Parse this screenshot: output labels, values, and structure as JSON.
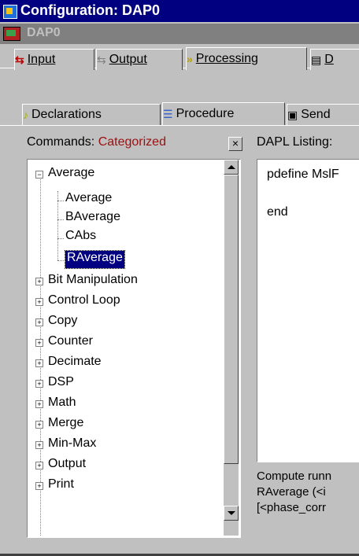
{
  "window": {
    "title": "Configuration: DAP0",
    "device": "DAP0"
  },
  "top_tabs": [
    {
      "label": "Input",
      "mnemonic": "I",
      "icon": "input-icon"
    },
    {
      "label": "Output",
      "mnemonic": "O",
      "icon": "output-icon"
    },
    {
      "label": "Processing",
      "mnemonic": "P",
      "icon": "processing-icon"
    },
    {
      "label": "D",
      "icon": "document-icon"
    }
  ],
  "sub_tabs": [
    {
      "label": "Declarations",
      "icon": "declarations-icon"
    },
    {
      "label": "Procedure",
      "icon": "procedure-icon"
    },
    {
      "label": "Send",
      "icon": "send-icon"
    }
  ],
  "commands": {
    "label": "Commands:",
    "mode": "Categorized",
    "close_label": "×",
    "tree": [
      {
        "label": "Average",
        "expanded": true,
        "children": [
          "Average",
          "BAverage",
          "CAbs",
          "RAverage"
        ],
        "selected_child": "RAverage"
      },
      {
        "label": "Bit Manipulation"
      },
      {
        "label": "Control Loop"
      },
      {
        "label": "Copy"
      },
      {
        "label": "Counter"
      },
      {
        "label": "Decimate"
      },
      {
        "label": "DSP"
      },
      {
        "label": "Math"
      },
      {
        "label": "Merge"
      },
      {
        "label": "Min-Max"
      },
      {
        "label": "Output"
      },
      {
        "label": "Print"
      }
    ]
  },
  "listing": {
    "label": "DAPL Listing:",
    "lines": [
      "pdefine MslF",
      "",
      "end"
    ]
  },
  "help": {
    "lines": [
      "Compute runn",
      "RAverage (<i",
      "[<phase_corr"
    ]
  }
}
